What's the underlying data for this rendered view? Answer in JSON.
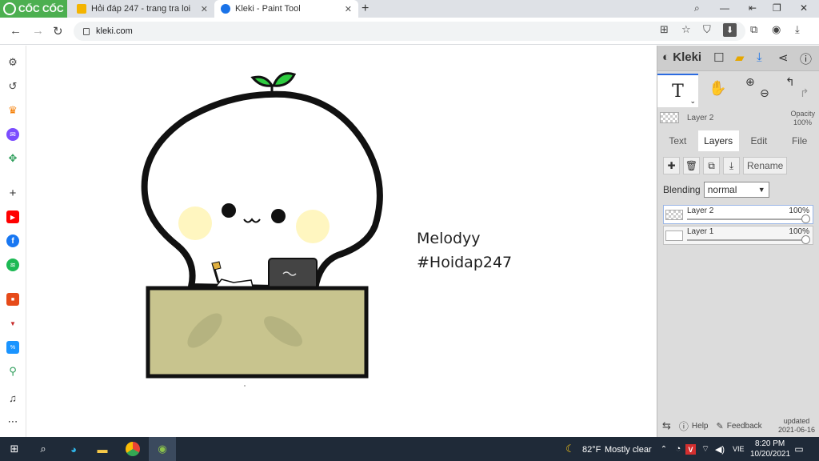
{
  "browser": {
    "brand": "CỐC CỐC",
    "tabs": [
      {
        "title": "Hỏi đáp 247 - trang tra loi",
        "color": "#f4b400"
      },
      {
        "title": "Kleki - Paint Tool",
        "color": "#1a73e8"
      }
    ],
    "url": "kleki.com"
  },
  "signature": {
    "line1": "Melodyy",
    "line2": "#Hoidap247"
  },
  "kleki": {
    "logo": "Kleki",
    "active_tool": "T",
    "layer_name": "Layer 2",
    "opacity_label": "Opacity",
    "opacity_value": "100%",
    "tabs": [
      "Text",
      "Layers",
      "Edit",
      "File"
    ],
    "active_tab": "Layers",
    "rename_label": "Rename",
    "blending_label": "Blending",
    "blending_value": "normal",
    "layers": [
      {
        "name": "Layer 2",
        "opacity": "100%"
      },
      {
        "name": "Layer 1",
        "opacity": "100%"
      }
    ],
    "help_label": "Help",
    "feedback_label": "Feedback",
    "updated_label": "updated",
    "updated_date": "2021-06-16"
  },
  "taskbar": {
    "weather_temp": "82°F",
    "weather_desc": "Mostly clear",
    "language": "VIE",
    "time": "8:20 PM",
    "date": "10/20/2021"
  },
  "colors": {
    "brand_green": "#4caf50",
    "sprout": "#2ecc40",
    "desk": "#c8c48e",
    "cheek": "#fff6c0",
    "taskbar": "#1f2a38"
  }
}
